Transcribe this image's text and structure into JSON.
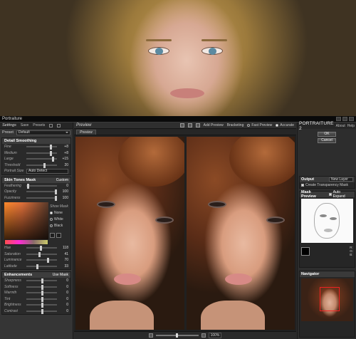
{
  "app": {
    "title": "Portraiture"
  },
  "left": {
    "tabs": {
      "settings": "Settings",
      "save": "Save",
      "presets": "Presets"
    },
    "preset": {
      "label": "Preset",
      "value": "Default"
    },
    "detail": {
      "title": "Detail Smoothing",
      "rows": [
        {
          "label": "Fine",
          "value": "+8"
        },
        {
          "label": "Medium",
          "value": "+8"
        },
        {
          "label": "Large",
          "value": "+15"
        },
        {
          "label": "Threshold",
          "value": "20"
        }
      ],
      "format_label": "Portrait Size",
      "format_value": "Auto Detect"
    },
    "mask": {
      "title": "Skin Tones Mask",
      "custom": "Custom",
      "rows": [
        {
          "label": "Feathering",
          "value": "0"
        },
        {
          "label": "Opacity",
          "value": "100"
        },
        {
          "label": "Fuzziness",
          "value": "100"
        }
      ],
      "show_mask": "Show Mask",
      "options": [
        "None",
        "White",
        "Black"
      ],
      "lower_rows": [
        {
          "label": "Hue",
          "value": "118"
        },
        {
          "label": "Saturation",
          "value": "41"
        },
        {
          "label": "Luminance",
          "value": "70"
        },
        {
          "label": "Latitude",
          "value": "33"
        }
      ]
    },
    "enh": {
      "title": "Enhancements",
      "use_mask": "Use Mask",
      "rows": [
        {
          "label": "Sharpness",
          "value": "0"
        },
        {
          "label": "Softness",
          "value": "0"
        },
        {
          "label": "Warmth",
          "value": "0"
        },
        {
          "label": "Tint",
          "value": "0"
        },
        {
          "label": "Brightness",
          "value": "0"
        },
        {
          "label": "Contrast",
          "value": "0"
        }
      ]
    }
  },
  "center": {
    "preview": "Preview",
    "add_preview": "Add Preview",
    "bracketing": "Bracketing",
    "fast_preview": "Fast Preview",
    "accurate": "Accurate",
    "tab": "Preview",
    "zoom": "100%"
  },
  "right": {
    "logo": "PORTRAITURE 2",
    "about": "About",
    "help": "Help",
    "ok": "OK",
    "cancel": "Cancel",
    "output": {
      "label": "Output",
      "value": "New Layer"
    },
    "transparency": "Create Transparency Mask",
    "mask_preview": "Mask Preview",
    "auto_expand": "Auto Expand",
    "rgb": [
      "R:",
      "G:",
      "B:"
    ],
    "navigator": "Navigator"
  }
}
